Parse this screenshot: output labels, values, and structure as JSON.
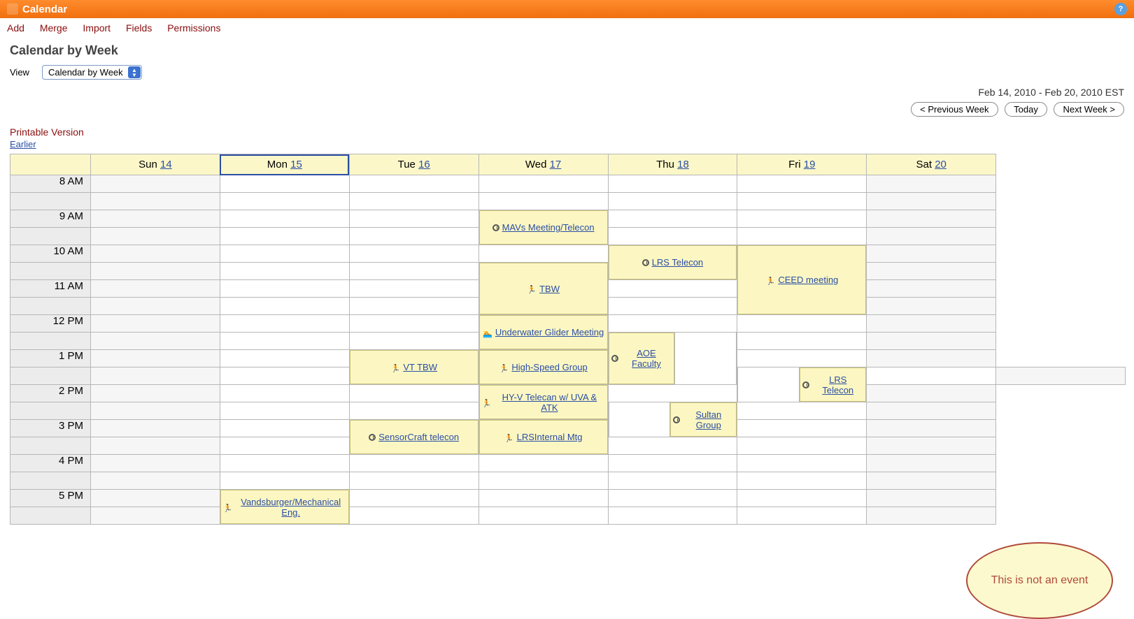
{
  "titlebar": {
    "title": "Calendar"
  },
  "menubar": {
    "add": "Add",
    "merge": "Merge",
    "import": "Import",
    "fields": "Fields",
    "permissions": "Permissions"
  },
  "heading": "Calendar by Week",
  "view": {
    "label": "View",
    "selected": "Calendar by Week"
  },
  "daterange": "Feb 14, 2010 - Feb 20, 2010 EST",
  "nav": {
    "prev": "< Previous Week",
    "today": "Today",
    "next": "Next Week >"
  },
  "printable": "Printable Version",
  "earlier": "Earlier",
  "days": {
    "sun": {
      "label": "Sun",
      "num": "14"
    },
    "mon": {
      "label": "Mon",
      "num": "15"
    },
    "tue": {
      "label": "Tue",
      "num": "16"
    },
    "wed": {
      "label": "Wed",
      "num": "17"
    },
    "thu": {
      "label": "Thu",
      "num": "18"
    },
    "fri": {
      "label": "Fri",
      "num": "19"
    },
    "sat": {
      "label": "Sat",
      "num": "20"
    }
  },
  "hours": {
    "h8": "8 AM",
    "h9": "9 AM",
    "h10": "10 AM",
    "h11": "11 AM",
    "h12": "12 PM",
    "h13": "1 PM",
    "h14": "2 PM",
    "h15": "3 PM",
    "h16": "4 PM",
    "h17": "5 PM"
  },
  "events": {
    "mavs": "MAVs Meeting/Telecon",
    "lrs_telecon_thu": "LRS Telecon",
    "ceed": "CEED meeting",
    "tbw": "TBW",
    "uwglider": "Underwater Glider Meeting",
    "aoe": "AOE Faculty",
    "vt_tbw": "VT TBW",
    "hsgroup": "High-Speed Group",
    "lrs_telecon_thu2": "LRS Telecon",
    "hyv": "HY-V Telecan w/ UVA & ATK",
    "sultan": "Sultan Group",
    "sensorcraft": "SensorCraft telecon",
    "lrsinternal": "LRSInternal Mtg",
    "vandsburger": "Vandsburger/Mechanical Eng."
  },
  "annotation": "This is not an event"
}
